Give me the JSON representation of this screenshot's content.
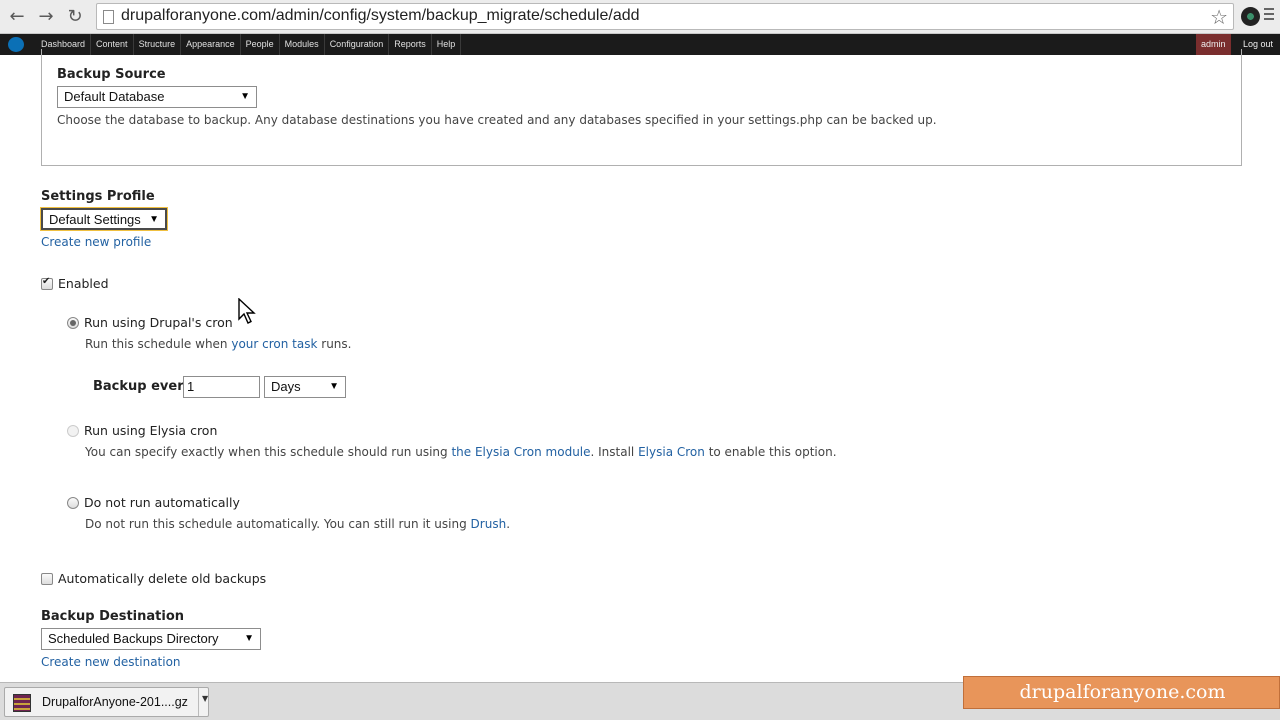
{
  "browser": {
    "url": "drupalforanyone.com/admin/config/system/backup_migrate/schedule/add"
  },
  "toolbar": {
    "items": [
      "Dashboard",
      "Content",
      "Structure",
      "Appearance",
      "People",
      "Modules",
      "Configuration",
      "Reports",
      "Help"
    ],
    "admin_label": "admin",
    "logout_label": "Log out"
  },
  "form": {
    "backup_source": {
      "label": "Backup Source",
      "value": "Default Database",
      "description": "Choose the database to backup. Any database destinations you have created and any databases specified in your settings.php can be backed up."
    },
    "settings_profile": {
      "label": "Settings Profile",
      "value": "Default Settings",
      "link": "Create new profile"
    },
    "enabled": {
      "label": "Enabled",
      "checked": true
    },
    "run_drupal_cron": {
      "label": "Run using Drupal's cron",
      "desc_before": "Run this schedule when ",
      "desc_link": "your cron task",
      "desc_after": " runs.",
      "selected": true
    },
    "backup_every": {
      "label": "Backup every",
      "value": "1",
      "unit": "Days"
    },
    "run_elysia_cron": {
      "label": "Run using Elysia cron",
      "desc_before": "You can specify exactly when this schedule should run using ",
      "desc_link1": "the Elysia Cron module",
      "desc_middle": ". Install ",
      "desc_link2": "Elysia Cron",
      "desc_after": " to enable this option.",
      "disabled": true
    },
    "no_auto": {
      "label": "Do not run automatically",
      "desc_before": "Do not run this schedule automatically. You can still run it using ",
      "desc_link": "Drush",
      "desc_after": "."
    },
    "auto_delete": {
      "label": "Automatically delete old backups",
      "checked": false
    },
    "backup_destination": {
      "label": "Backup Destination",
      "value": "Scheduled Backups Directory",
      "link": "Create new destination"
    }
  },
  "downloads": {
    "file_name": "DrupalforAnyone-201....gz"
  },
  "watermark": {
    "text": "drupalforanyone.com",
    "color": "#e8955a"
  },
  "colors": {
    "link": "#2261a2",
    "toolbar_bg": "#1b1b1b",
    "admin_bg": "#7a2e2e"
  }
}
